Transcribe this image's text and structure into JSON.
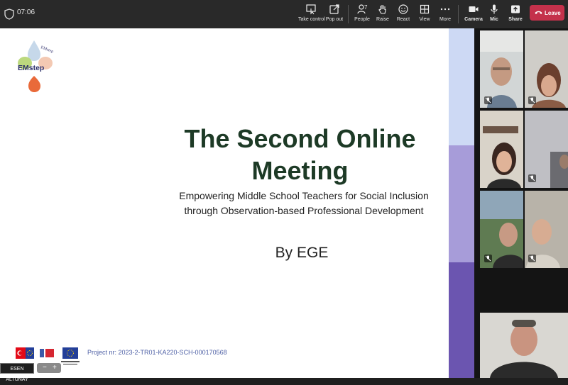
{
  "toolbar": {
    "timer": "07:06",
    "buttons": {
      "take_control": "Take control",
      "pop_out": "Pop out",
      "people": "People",
      "people_count": "7",
      "raise": "Raise",
      "react": "React",
      "view": "View",
      "more": "More",
      "camera": "Camera",
      "mic": "Mic",
      "share": "Share",
      "leave": "Leave"
    },
    "colors": {
      "bar": "#292929",
      "leave": "#c4314b"
    }
  },
  "slide": {
    "logo_text": "EMstep",
    "title_line1": "The Second Online",
    "title_line2": "Meeting",
    "subtitle_line1": "Empowering Middle School Teachers for Social Inclusion",
    "subtitle_line2": "through Observation-based Professional Development",
    "by": "By EGE",
    "project": "Project nr:  2023-2-TR01-KA220-SCH-000170568",
    "presenter_name": "ESEN ALTUNAY",
    "zoom_minus": "−",
    "zoom_plus": "+",
    "colors": {
      "title": "#1d3a26",
      "project": "#4f61a6"
    }
  },
  "gallery": {
    "tile_count": 7,
    "colors": {
      "active_border": "#8b8cc7",
      "stripe": [
        "#cdd9f4",
        "#a79cd9",
        "#6b55b0"
      ]
    }
  }
}
